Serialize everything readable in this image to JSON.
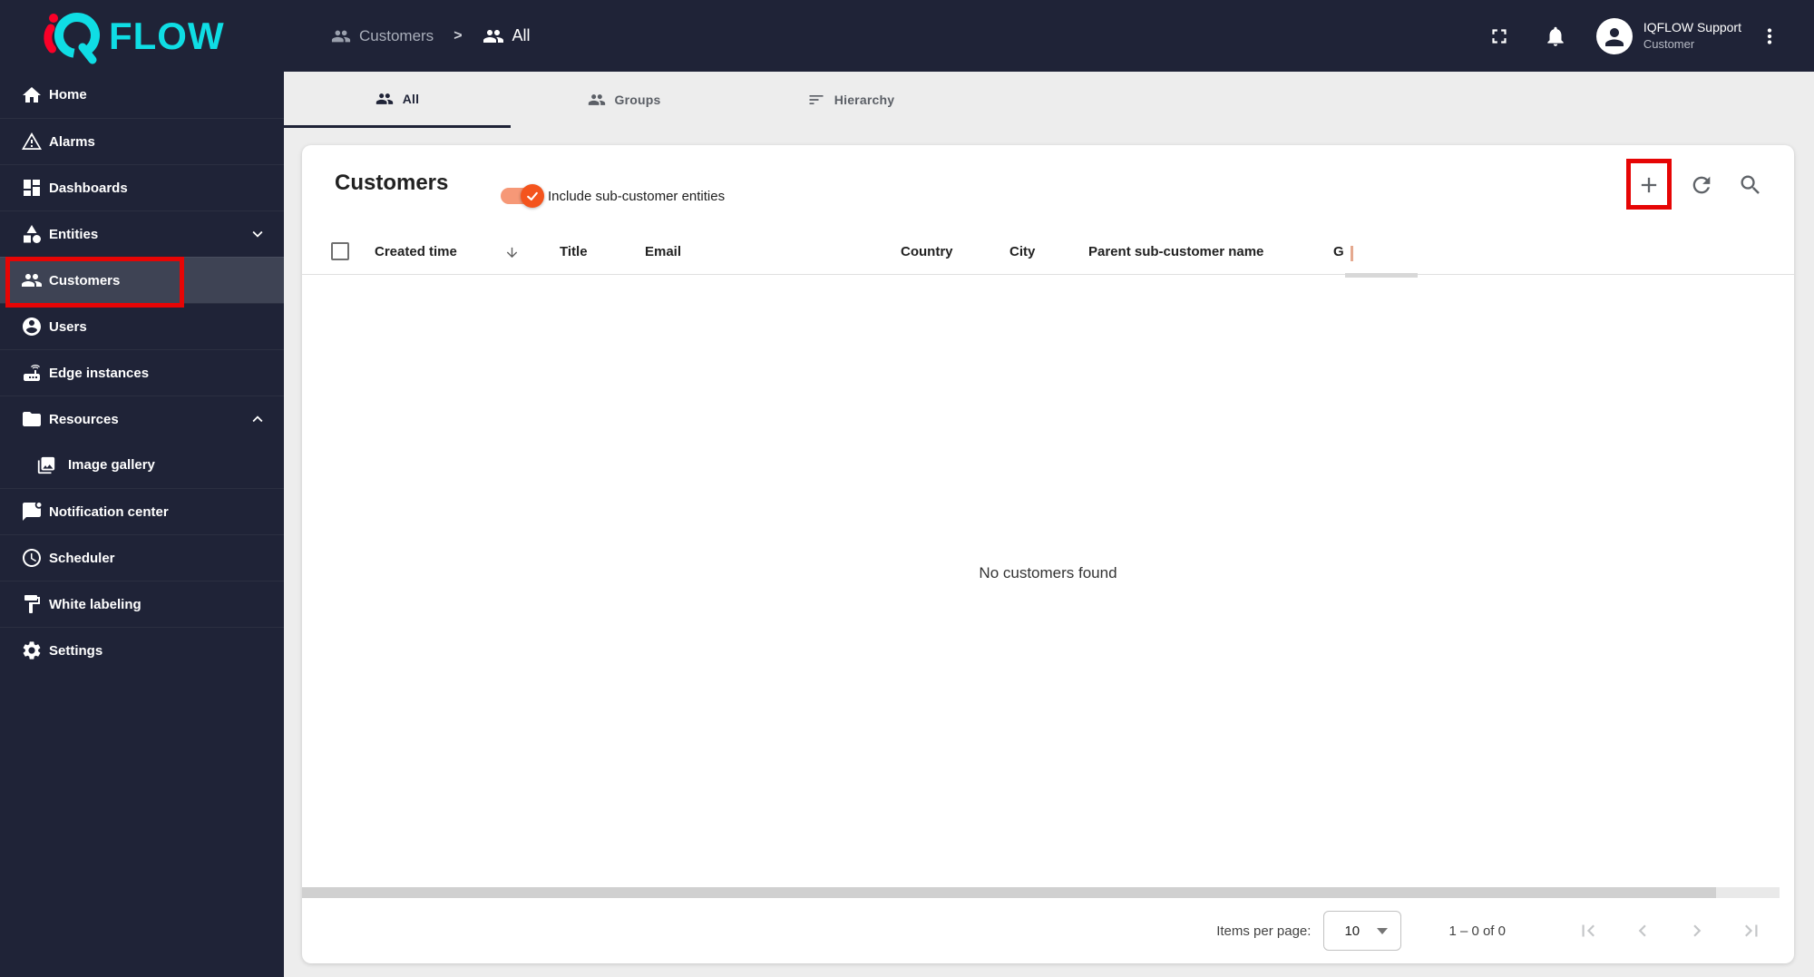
{
  "topbar": {
    "logo_text": "FLOW",
    "breadcrumb": {
      "separator": ">",
      "items": [
        {
          "label": "Customers"
        },
        {
          "label": "All"
        }
      ]
    },
    "user": {
      "name": "IQFLOW Support",
      "role": "Customer"
    }
  },
  "sidebar": {
    "items": [
      {
        "label": "Home"
      },
      {
        "label": "Alarms"
      },
      {
        "label": "Dashboards"
      },
      {
        "label": "Entities",
        "expandable": "collapsed"
      },
      {
        "label": "Customers",
        "selected": true
      },
      {
        "label": "Users"
      },
      {
        "label": "Edge instances"
      },
      {
        "label": "Resources",
        "expandable": "expanded"
      },
      {
        "label": "Image gallery",
        "sub": true
      },
      {
        "label": "Notification center"
      },
      {
        "label": "Scheduler"
      },
      {
        "label": "White labeling"
      },
      {
        "label": "Settings"
      }
    ]
  },
  "tabs": [
    {
      "label": "All",
      "active": true
    },
    {
      "label": "Groups",
      "active": false
    },
    {
      "label": "Hierarchy",
      "active": false
    }
  ],
  "content": {
    "title": "Customers",
    "toggle": {
      "label": "Include sub-customer entities",
      "on": true
    },
    "table": {
      "columns": [
        {
          "label": "Created time",
          "sorted": "desc"
        },
        {
          "label": "Title"
        },
        {
          "label": "Email"
        },
        {
          "label": "Country"
        },
        {
          "label": "City"
        },
        {
          "label": "Parent sub-customer name"
        },
        {
          "label": "G",
          "truncated": true
        }
      ],
      "empty_message": "No customers found"
    },
    "paginator": {
      "label": "Items per page:",
      "page_size": "10",
      "range": "1 – 0 of 0"
    }
  },
  "icons": {
    "sort_descending": "↓",
    "dropdown_arrow": "▼",
    "toggle_check": "✓"
  },
  "colors": {
    "topbar_navy": "#1f2337",
    "accent_cyan": "#0fdde4",
    "logo_red": "#fa0028",
    "toggle_orange": "#f4541d",
    "selected_item_bg": "#3e4354",
    "annotation_red": "#e60505"
  },
  "annotations": [
    {
      "target": "sidebar-item-customers"
    },
    {
      "target": "add-customer-button"
    }
  ]
}
